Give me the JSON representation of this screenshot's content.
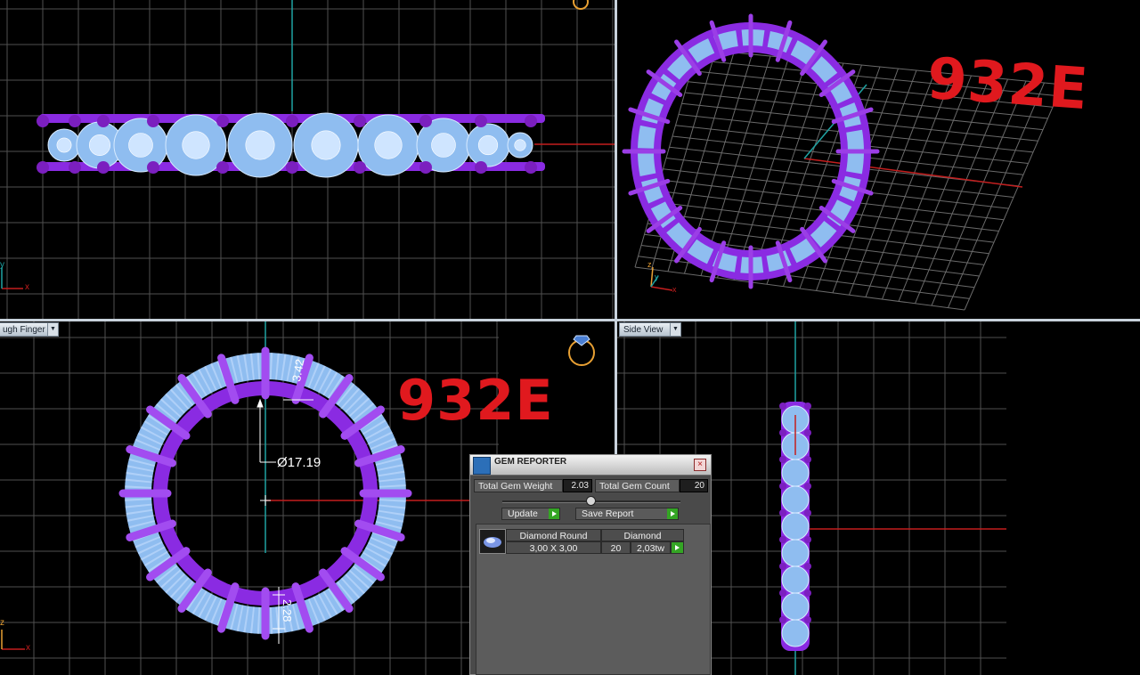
{
  "viewports": {
    "top_left": {
      "axis_x": "x",
      "axis_y": "y"
    },
    "top_right": {
      "code_label": "932E",
      "axis_x": "x",
      "axis_y": "y",
      "axis_z": "z"
    },
    "bottom_left": {
      "view_name": "ugh Finger",
      "code_label": "932E",
      "dim_inner_diameter": "Ø17.19",
      "dim_top_height": "3.42",
      "dim_bottom_height": "2.28",
      "axis_z": "z",
      "axis_x": "x"
    },
    "bottom_right": {
      "view_name": "Side View"
    }
  },
  "gem_reporter": {
    "title": "GEM REPORTER",
    "close": "×",
    "total_gem_weight_label": "Total Gem Weight",
    "total_gem_weight_value": "2.03",
    "total_gem_count_label": "Total Gem Count",
    "total_gem_count_value": "20",
    "update_label": "Update",
    "save_report_label": "Save Report",
    "rows": [
      {
        "shape": "Diamond Round",
        "material": "Diamond",
        "size": "3,00 X 3,00",
        "count": "20",
        "weight": "2,03tw"
      }
    ]
  },
  "colors": {
    "metal": "#8a2be2",
    "gem": "#8fbdf0",
    "grid": "#5a5a5a",
    "axis_x": "#c41e1e",
    "axis_y": "#1fa2a2",
    "label": "#e0191e"
  }
}
